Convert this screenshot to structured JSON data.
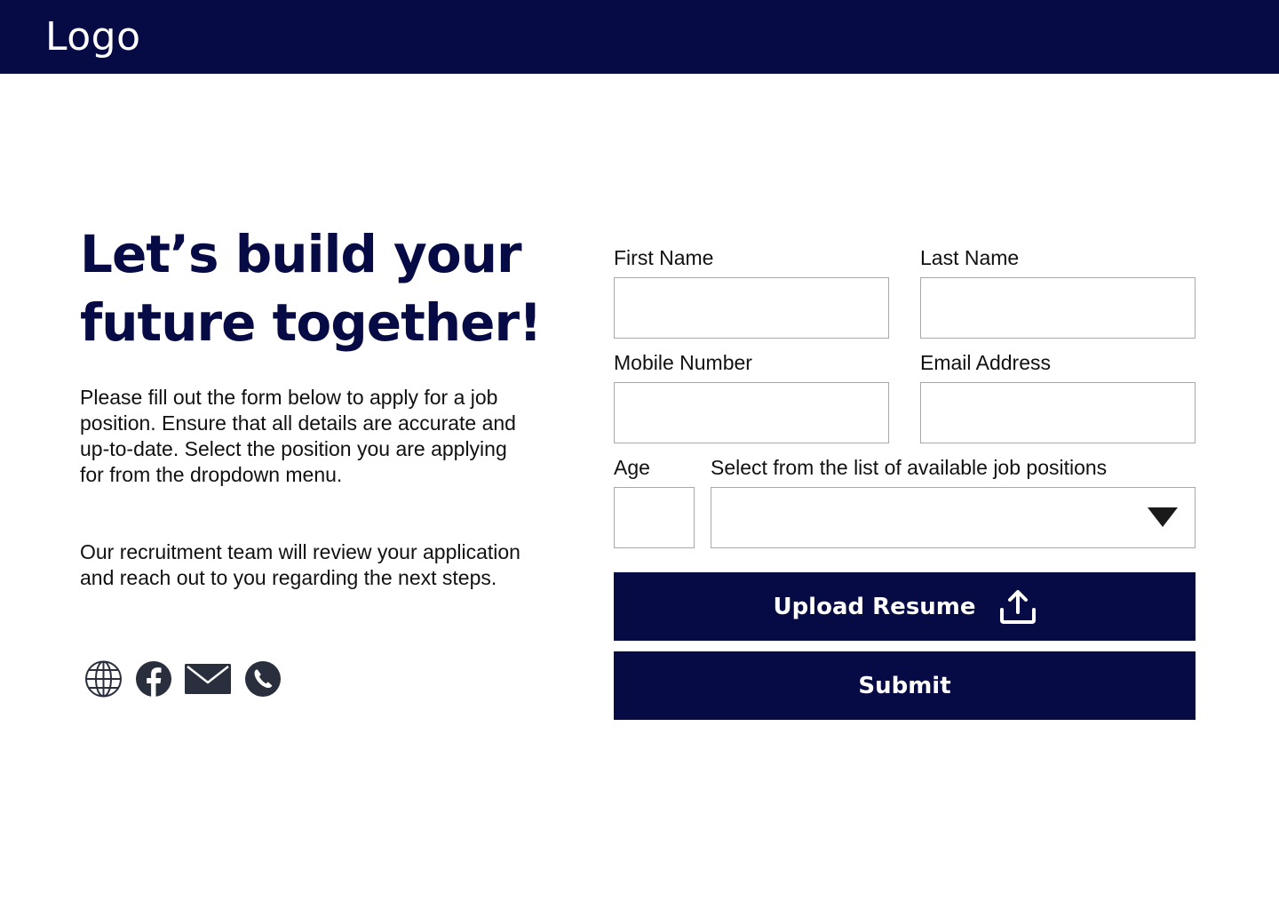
{
  "header": {
    "logo_text": "Logo",
    "background_color": "#060b45"
  },
  "hero": {
    "headline_line1": "Let’s build your",
    "headline_line2": "future together!",
    "paragraph1": "Please fill out the form below to apply for a job position. Ensure that all details are accurate and up-to-date. Select the position you are applying for from the dropdown menu.",
    "paragraph2": "Our recruitment team will review your application and reach out to you regarding the next steps."
  },
  "social_icons": [
    "globe-icon",
    "facebook-icon",
    "mail-icon",
    "phone-icon"
  ],
  "form": {
    "first_name": {
      "label": "First Name",
      "value": ""
    },
    "last_name": {
      "label": "Last Name",
      "value": ""
    },
    "mobile_number": {
      "label": "Mobile Number",
      "value": ""
    },
    "email_address": {
      "label": "Email Address",
      "value": ""
    },
    "age": {
      "label": "Age",
      "value": ""
    },
    "job_position": {
      "label": "Select from the list of available job positions",
      "selected": ""
    },
    "upload_button_label": "Upload Resume",
    "submit_button_label": "Submit"
  },
  "colors": {
    "primary": "#060b45",
    "text": "#111111",
    "field_border": "#a9a9a9",
    "icon": "#2a2f3e"
  }
}
